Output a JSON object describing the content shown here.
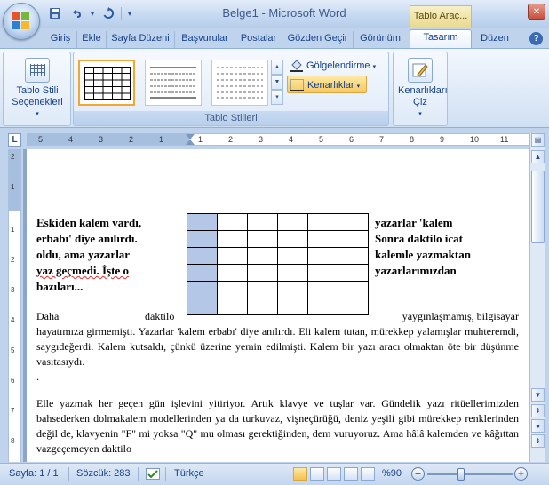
{
  "window": {
    "title": "Belge1 - Microsoft Word",
    "tools_tab": "Tablo Araç...",
    "minimize": "–",
    "close": "✕"
  },
  "quick_access": {
    "save_icon": "save-icon",
    "undo_icon": "undo-icon",
    "redo_icon": "redo-icon",
    "customize_icon": "customize-icon"
  },
  "tabs": [
    "Giriş",
    "Ekle",
    "Sayfa Düzeni",
    "Başvurular",
    "Postalar",
    "Gözden Geçir",
    "Görünüm",
    "Tasarım",
    "Düzen"
  ],
  "active_tab": "Tasarım",
  "ribbon": {
    "table_style_options": "Tablo Stili Seçenekleri",
    "shading": "Gölgelendirme",
    "borders": "Kenarlıklar",
    "table_styles_group": "Tablo Stilleri",
    "draw_borders": "Kenarlıkları Çiz"
  },
  "ruler": {
    "numbers": [
      "5",
      "4",
      "3",
      "2",
      "1",
      "1",
      "2",
      "3",
      "4",
      "5",
      "6",
      "7",
      "8",
      "9",
      "10",
      "11"
    ],
    "vertical_numbers": [
      "2",
      "1",
      "1",
      "2",
      "3",
      "4",
      "5",
      "6",
      "7",
      "8"
    ]
  },
  "document": {
    "float_left": [
      "Eskiden kalem vardı,",
      "erbabı' diye anılırdı.",
      "oldu, ama yazarlar",
      "yaz geçmedi. İşte o",
      "bazıları..."
    ],
    "float_right": [
      "yazarlar 'kalem",
      "Sonra daktilo icat",
      "kalemle yazmaktan",
      "yazarlarımızdan"
    ],
    "para1_start": "Daha",
    "para1_word2": "daktilo",
    "para1_rest_first": "yaygınlaşmamış, bilgisayar",
    "para1_body": "hayatımıza girmemişti. Yazarlar 'kalem erbabı' diye anılırdı. Eli kalem tutan, mürekkep yalamışlar muhteremdi, saygıdeğerdi. Kalem kutsaldı, çünkü üzerine yemin edilmişti. Kalem bir yazı aracı olmaktan öte bir düşünme vasıtasıydı.",
    "para1_dot": ".",
    "para2": "Elle yazmak her geçen gün işlevini yitiriyor. Artık klavye ve tuşlar var. Gündelik yazı ritüellerimizden bahsederken dolmakalem modellerinden ya da turkuvaz, vişneçürüğü, deniz yeşili gibi mürekkep renklerinden değil de, klavyenin \"F\" mi yoksa \"Q\" mu olması gerektiğinden, dem vuruyoruz. Ama hâlâ kalemden ve kâğıttan vazgeçemeyen daktilo",
    "table": {
      "rows": 6,
      "cols": 6,
      "selected_col": 0
    }
  },
  "status": {
    "page": "Sayfa: 1 / 1",
    "words": "Sözcük: 283",
    "language": "Türkçe",
    "zoom": "%90",
    "zoom_level": 0.9,
    "zoom_minus": "−",
    "zoom_plus": "+"
  },
  "colors": {
    "ribbon_bg": "#dbe7f6",
    "selection": "#b4c7e7",
    "highlight": "#f8c860"
  }
}
